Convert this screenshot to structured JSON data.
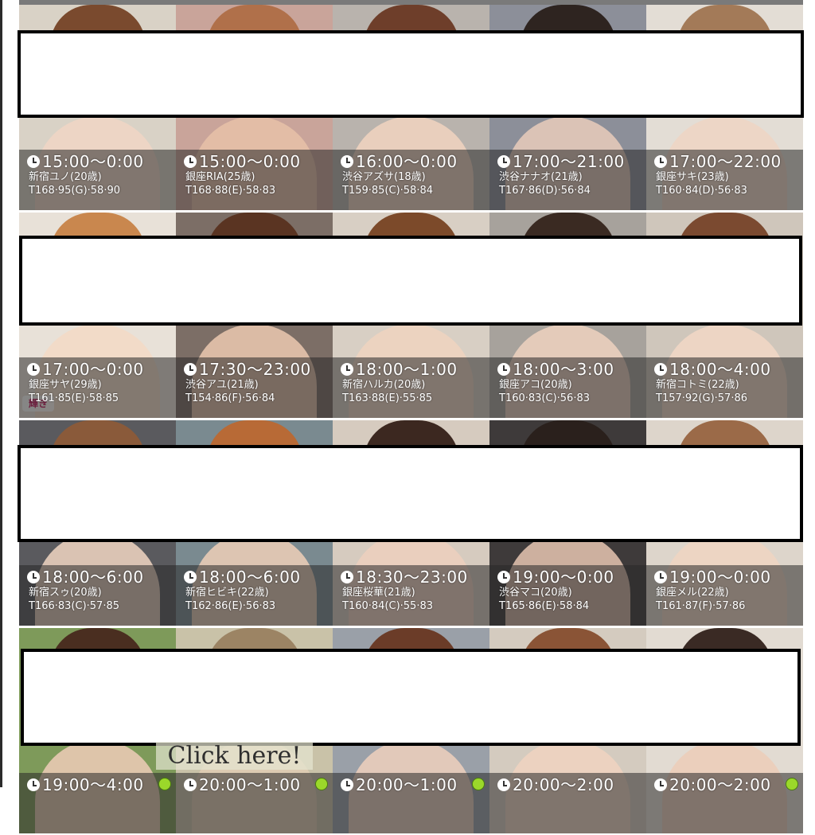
{
  "overlay_note": "",
  "new_badge_label": "輝き",
  "click_banner": "Click here!",
  "rows": [
    [
      {
        "time": "15:00〜0:00",
        "name": "新宿ユノ(20歳)",
        "stats": "T168·95(G)·58·90",
        "hair": "#7a4a2e",
        "skin": "#f0d6c4",
        "bg": "#d9d2c6"
      },
      {
        "time": "15:00〜0:00",
        "name": "銀座RIA(25歳)",
        "stats": "T168·88(E)·58·83",
        "hair": "#b0704a",
        "skin": "#e8c2a8",
        "bg": "#c9a49a"
      },
      {
        "time": "16:00〜0:00",
        "name": "渋谷アズサ(18歳)",
        "stats": "T159·85(C)·58·84",
        "hair": "#6e3e2a",
        "skin": "#f1d3c0",
        "bg": "#b9b3ad"
      },
      {
        "time": "17:00〜21:00",
        "name": "渋谷ナナオ(21歳)",
        "stats": "T167·86(D)·56·84",
        "hair": "#2e2420",
        "skin": "#e9cdbb",
        "bg": "#8c8f99"
      },
      {
        "time": "17:00〜22:00",
        "name": "銀座サキ(23歳)",
        "stats": "T160·84(D)·56·83",
        "hair": "#a37a58",
        "skin": "#efd5c3",
        "bg": "#e3ddd5"
      }
    ],
    [
      {
        "time": "17:00〜0:00",
        "name": "銀座サヤ(29歳)",
        "stats": "T161·85(E)·58·85",
        "hair": "#c9874e",
        "skin": "#f3d9c6",
        "bg": "#e8e1d8"
      },
      {
        "time": "17:30〜23:00",
        "name": "渋谷アユ(21歳)",
        "stats": "T154·86(F)·56·84",
        "hair": "#5a3422",
        "skin": "#ecc9b0",
        "bg": "#7c6e66"
      },
      {
        "time": "18:00〜1:00",
        "name": "新宿ハルカ(20歳)",
        "stats": "T163·88(E)·55·85",
        "hair": "#7c4a2a",
        "skin": "#f0d3bf",
        "bg": "#d8cfc4"
      },
      {
        "time": "18:00〜3:00",
        "name": "銀座アコ(20歳)",
        "stats": "T160·83(C)·56·83",
        "hair": "#3a2a22",
        "skin": "#eed2c0",
        "bg": "#a7a29c"
      },
      {
        "time": "18:00〜4:00",
        "name": "新宿コトミ(22歳)",
        "stats": "T157·92(G)·57·86",
        "hair": "#7b4a30",
        "skin": "#f2d7c5",
        "bg": "#cfc6bb"
      }
    ],
    [
      {
        "time": "18:00〜6:00",
        "name": "新宿スゥ(20歳)",
        "stats": "T166·83(C)·57·85",
        "hair": "#8a5a3a",
        "skin": "#f1d6c2",
        "bg": "#5a5a5e"
      },
      {
        "time": "18:00〜6:00",
        "name": "新宿ヒビキ(22歳)",
        "stats": "T162·86(E)·56·83",
        "hair": "#b86a36",
        "skin": "#efcfb8",
        "bg": "#7a8a90"
      },
      {
        "time": "18:30〜23:00",
        "name": "銀座桜華(21歳)",
        "stats": "T160·84(C)·55·83",
        "hair": "#3c2820",
        "skin": "#edd0bd",
        "bg": "#d6cbbf"
      },
      {
        "time": "19:00〜0:00",
        "name": "渋谷マコ(20歳)",
        "stats": "T165·86(E)·58·84",
        "hair": "#2a201c",
        "skin": "#e6c6b2",
        "bg": "#3e3a3a"
      },
      {
        "time": "19:00〜0:00",
        "name": "銀座メル(22歳)",
        "stats": "T161·87(F)·57·86",
        "hair": "#9b6a48",
        "skin": "#f0d5c2",
        "bg": "#ddd5cb"
      }
    ],
    [
      {
        "time": "19:00〜4:00",
        "name": "",
        "stats": "",
        "hair": "#4a2e20",
        "skin": "#eecdb8",
        "bg": "#7e9a5a"
      },
      {
        "time": "20:00〜1:00",
        "name": "",
        "stats": "",
        "hair": "#9c8464",
        "skin": "#e0cdb4",
        "bg": "#c9c2a8"
      },
      {
        "time": "20:00〜1:00",
        "name": "",
        "stats": "",
        "hair": "#6b3c28",
        "skin": "#efd0bd",
        "bg": "#9aa0a8"
      },
      {
        "time": "20:00〜2:00",
        "name": "",
        "stats": "",
        "hair": "#8a5436",
        "skin": "#f0d3c0",
        "bg": "#d4cbbf"
      },
      {
        "time": "20:00〜2:00",
        "name": "",
        "stats": "",
        "hair": "#3a2a24",
        "skin": "#eccdb9",
        "bg": "#e2dbd2"
      }
    ]
  ]
}
